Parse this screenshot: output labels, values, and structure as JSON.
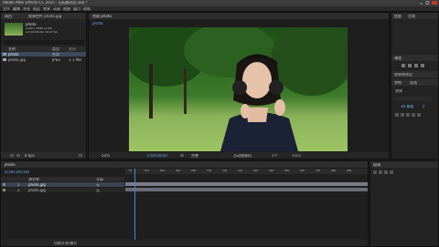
{
  "app": {
    "title": "Adobe After Effects CC 2015 - 无标题项目.aep *"
  },
  "menu": {
    "items": [
      "文件",
      "编辑",
      "合成",
      "图层",
      "效果",
      "动画",
      "视图",
      "窗口",
      "帮助"
    ]
  },
  "toolbar": {
    "workspace_label": "默认",
    "search_placeholder": "搜索帮助"
  },
  "project_panel": {
    "tab_label": "项目",
    "effect_tab_label": "效果控件 photo.jpg",
    "thumb_name": "photo",
    "thumb_meta": [
      "1920 x 1080 (1.00)",
      "Δ 0;00;00;00, 29.97 fps"
    ],
    "columns": [
      "名称",
      "类型",
      "大小"
    ],
    "items": [
      {
        "name": "photo",
        "type": "合成",
        "size": ""
      },
      {
        "name": "photo.jpg",
        "type": "JPEG",
        "size": "1.1 MB"
      }
    ],
    "bpc": "8 bpc"
  },
  "composition": {
    "tab_label": "合成 photo",
    "sub_tab": "photo",
    "zoom": "50%",
    "timecode": "0;00;00;00",
    "resolution": "完整",
    "camera": "活动摄像机",
    "views": "1个",
    "offset": "+0.0"
  },
  "right_panel": {
    "info_tab": "信息",
    "audio_tab": "音频",
    "preview_tab": "预览",
    "effects_tab": "效果和预设",
    "char_tab": "字符",
    "para_tab": "段落",
    "font_size": "36 像素",
    "tracking": "0",
    "font_name": "黑体"
  },
  "timeline": {
    "comp_tab": "photo",
    "timecode": "0;00;00;00",
    "columns": [
      "源名称",
      "父级"
    ],
    "layers": [
      {
        "num": "1",
        "name": "photo.jpg",
        "parent": "无"
      },
      {
        "num": "2",
        "name": "photo.jpg",
        "parent": "无"
      }
    ],
    "ruler_ticks": [
      "0s",
      "02s",
      "04s",
      "06s",
      "08s",
      "10s",
      "12s",
      "14s",
      "16s",
      "18s",
      "20s",
      "22s",
      "24s",
      "26s",
      "28s"
    ],
    "footer_label": "切换开关/模式"
  },
  "colors": {
    "accent": "#6aa9e8",
    "selected_layer": "#7b7b8a",
    "layer_bar": "#6a6a78"
  }
}
